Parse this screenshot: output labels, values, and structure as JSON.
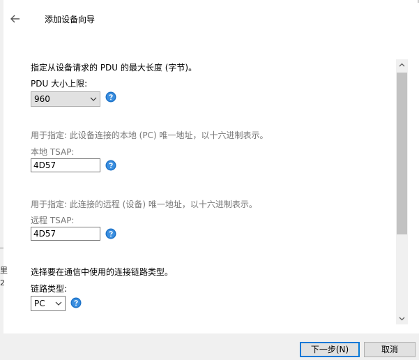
{
  "header": {
    "title": "添加设备向导"
  },
  "pdu": {
    "description": "指定从设备请求的  PDU 的最大长度 (字节)。",
    "label": "PDU 大小上限:",
    "value": "960"
  },
  "local_tsap": {
    "description": "用于指定: 此设备连接的本地 (PC) 唯一地址，以十六进制表示。",
    "label": "本地 TSAP:",
    "value": "4D57"
  },
  "remote_tsap": {
    "description": "用于指定: 此连接的远程 (设备) 唯一地址，以十六进制表示。",
    "label": "远程 TSAP:",
    "value": "4D57"
  },
  "link": {
    "description": "选择要在通信中使用的连接链路类型。",
    "label": "链路类型:",
    "value": "PC"
  },
  "footer": {
    "next_label": "下一步(N)",
    "cancel_label": "取消"
  },
  "background_window": {
    "glyph1": "里",
    "glyph2": "2"
  },
  "colors": {
    "help_icon": "#1e73c8",
    "primary_border": "#0078d7",
    "scroll_thumb": "#c2c2c2"
  }
}
